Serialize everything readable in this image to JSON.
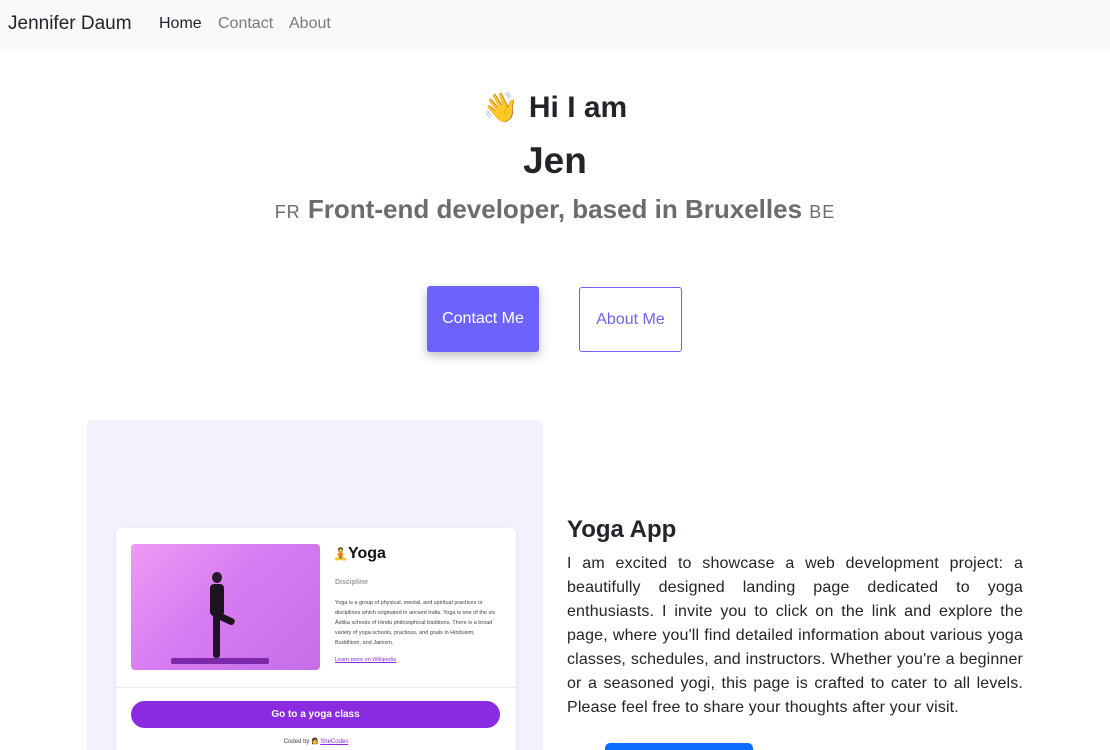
{
  "navbar": {
    "brand": "Jennifer Daum",
    "links": [
      "Home",
      "Contact",
      "About"
    ]
  },
  "hero": {
    "greeting": "Hi I am",
    "wave_emoji": "👋",
    "name": "Jen",
    "flag_left": "FR",
    "subtitle": "Front-end developer, based in Bruxelles",
    "flag_right": "BE"
  },
  "buttons": {
    "contact": "Contact Me",
    "about": "About Me"
  },
  "project": {
    "title": "Yoga App",
    "description": "I am excited to showcase a web development project: a beautifully designed landing page dedicated to yoga enthusiasts. I invite you to click on the link and explore the page, where you'll find detailed information about various yoga classes, schedules, and instructors. Whether you're a beginner or a seasoned yogi, this page is crafted to cater to all levels. Please feel free to share your thoughts after your visit.",
    "preview": {
      "title": "Yoga",
      "title_emoji": "🧘",
      "label": "Discipline",
      "text": "Yoga is a group of physical, mental, and spiritual practices or disciplines which originated in ancient India. Yoga is one of the six Āstika schools of Hindu philosophical traditions. There is a broad variety of yoga schools, practices, and goals in Hinduism, Buddhism, and Jainism.",
      "link": "Learn more on Wikipedia",
      "cta": "Go to a yoga class",
      "coded_by": "Coded by",
      "coded_emoji": "👩",
      "shecodes": "SheCodes"
    }
  },
  "colors": {
    "accent": "#6c63ff",
    "nav_bg": "#f8f9fa",
    "preview_bg": "#f3f1fe",
    "yoga_purple": "#8a2be2",
    "visit_blue": "#0d6efd"
  }
}
